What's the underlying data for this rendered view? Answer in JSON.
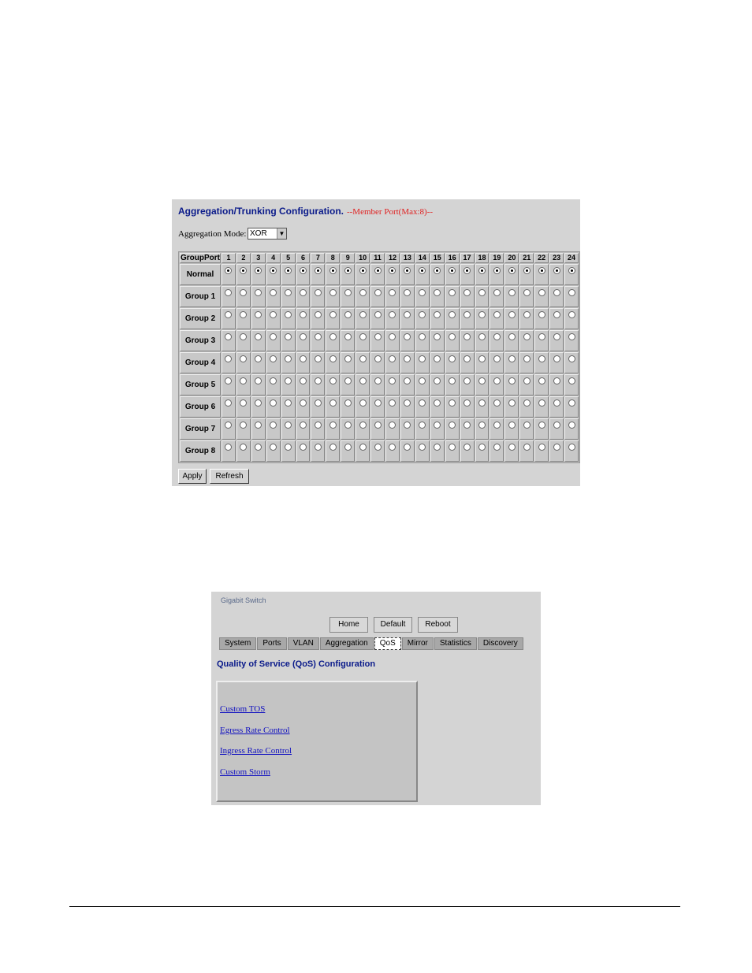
{
  "aggregation": {
    "title": "Aggregation/Trunking Configuration.",
    "note": "--Member Port(Max:8)--",
    "mode_label": "Aggregation Mode:",
    "mode_value": "XOR",
    "corner_header": "GroupPort",
    "ports": [
      "1",
      "2",
      "3",
      "4",
      "5",
      "6",
      "7",
      "8",
      "9",
      "10",
      "11",
      "12",
      "13",
      "14",
      "15",
      "16",
      "17",
      "18",
      "19",
      "20",
      "21",
      "22",
      "23",
      "24"
    ],
    "rows": [
      "Normal",
      "Group 1",
      "Group 2",
      "Group 3",
      "Group 4",
      "Group 5",
      "Group 6",
      "Group 7",
      "Group 8"
    ],
    "selected_row_per_port": "Normal",
    "apply_label": "Apply",
    "refresh_label": "Refresh"
  },
  "qos": {
    "brand": "Gigabit Switch",
    "nav": {
      "home": "Home",
      "default": "Default",
      "reboot": "Reboot"
    },
    "tabs": [
      "System",
      "Ports",
      "VLAN",
      "Aggregation",
      "QoS",
      "Mirror",
      "Statistics",
      "Discovery"
    ],
    "active_tab": "QoS",
    "title": "Quality of Service (QoS) Configuration",
    "links": [
      "Custom TOS",
      "Egress Rate Control",
      "Ingress Rate Control",
      "Custom Storm"
    ]
  }
}
